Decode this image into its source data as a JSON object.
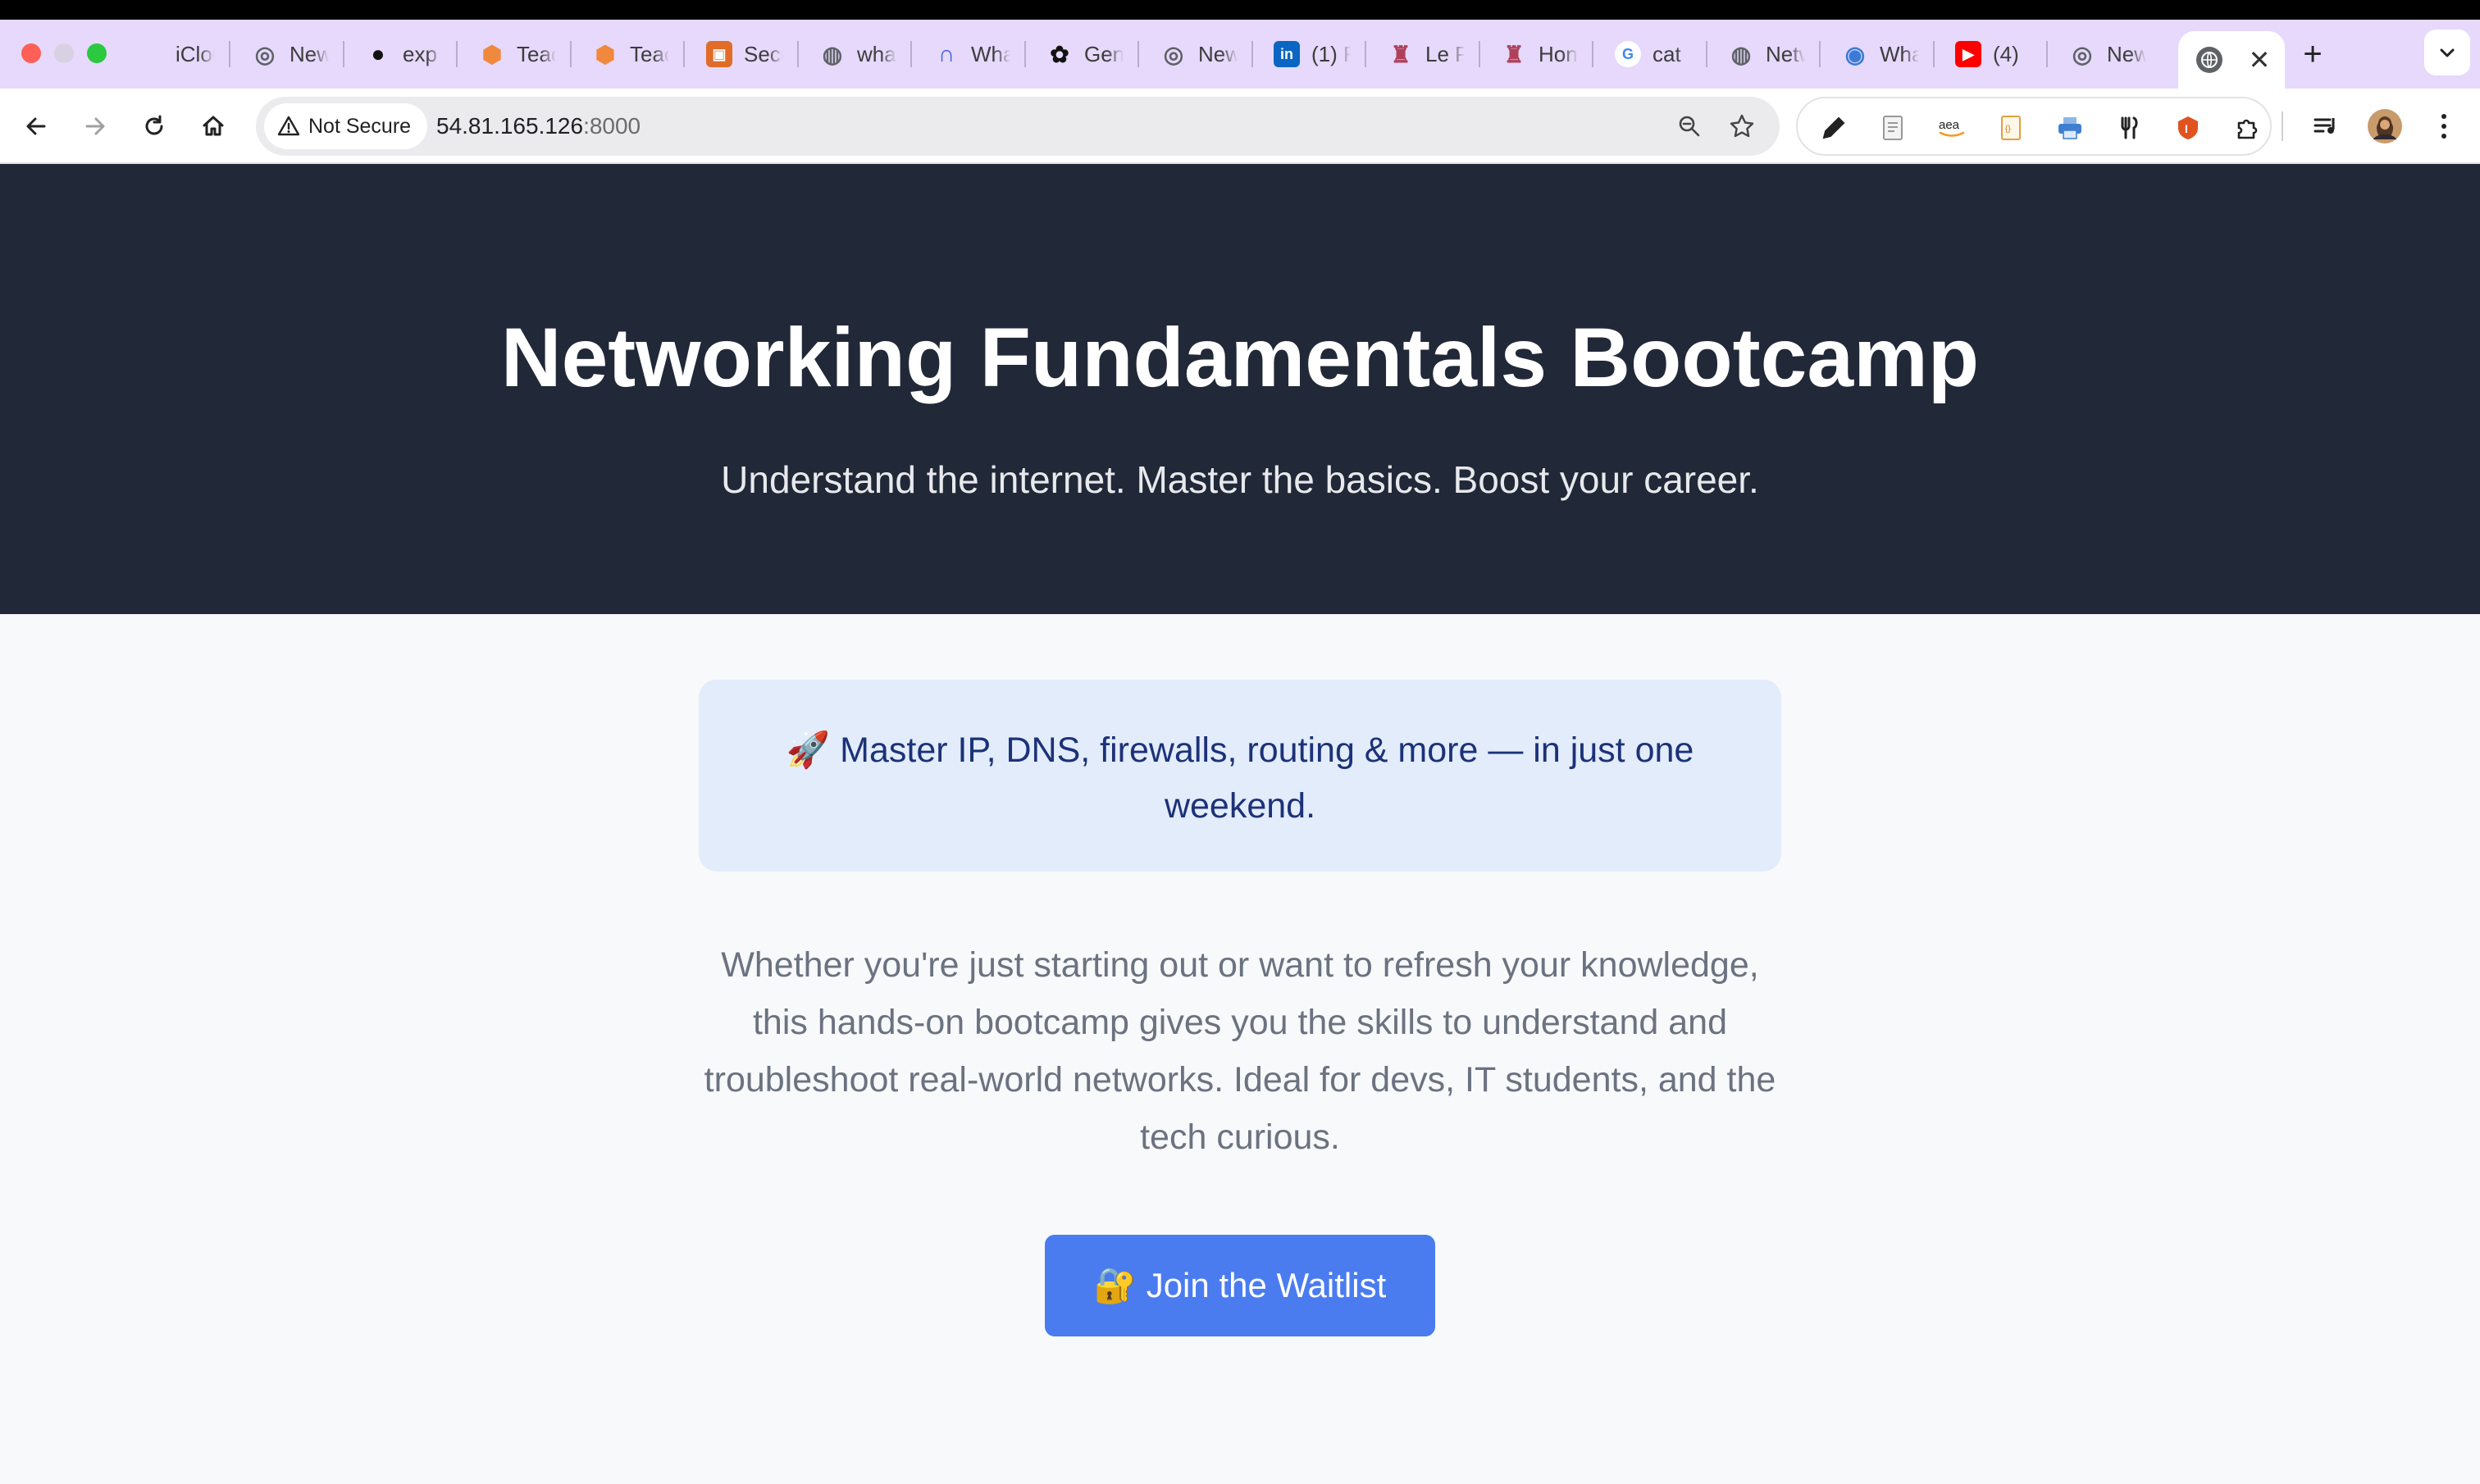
{
  "browser": {
    "tabs": [
      {
        "title": "iCloud",
        "icon": "apple-icon",
        "color": "#555555"
      },
      {
        "title": "New Tab",
        "icon": "chrome-icon",
        "color": "#5f6368"
      },
      {
        "title": "exp",
        "icon": "github-icon",
        "color": "#111111"
      },
      {
        "title": "Teach",
        "icon": "hexagon-icon",
        "color": "#f0883e"
      },
      {
        "title": "Teach",
        "icon": "hexagon-icon",
        "color": "#f0883e"
      },
      {
        "title": "Secu",
        "icon": "security-icon",
        "color": "#e06c27"
      },
      {
        "title": "wha",
        "icon": "globe-icon",
        "color": "#5f6368"
      },
      {
        "title": "Wha",
        "icon": "arc-icon",
        "color": "#3b5bdb"
      },
      {
        "title": "Gen",
        "icon": "openai-icon",
        "color": "#111111"
      },
      {
        "title": "New",
        "icon": "chrome-icon",
        "color": "#5f6368"
      },
      {
        "title": "(1) F",
        "icon": "linkedin-icon",
        "color": "#0a66c2"
      },
      {
        "title": "Le P",
        "icon": "tower-icon",
        "color": "#b0405a"
      },
      {
        "title": "Hon",
        "icon": "tower-icon",
        "color": "#b0405a"
      },
      {
        "title": "cat",
        "icon": "google-icon",
        "color": "#4285f4"
      },
      {
        "title": "Netw",
        "icon": "globe-icon",
        "color": "#5f6368"
      },
      {
        "title": "Wha",
        "icon": "earth-icon",
        "color": "#3a7bd5"
      },
      {
        "title": "(4)",
        "icon": "youtube-icon",
        "color": "#ff0000"
      },
      {
        "title": "New",
        "icon": "chrome-icon",
        "color": "#5f6368"
      }
    ],
    "active_tab_icon": "globe-icon",
    "address": {
      "security_label": "Not Secure",
      "host": "54.81.165.126",
      "port": ":8000"
    }
  },
  "page": {
    "title": "Networking Fundamentals Bootcamp",
    "subtitle": "Understand the internet. Master the basics. Boost your career.",
    "callout": "🚀 Master IP, DNS, firewalls, routing & more — in just one weekend.",
    "description": "Whether you're just starting out or want to refresh your knowledge, this hands-on bootcamp gives you the skills to understand and troubleshoot real-world networks. Ideal for devs, IT students, and the tech curious.",
    "cta_label": "🔐 Join the Waitlist"
  },
  "colors": {
    "hero_bg": "#212838",
    "callout_bg": "#e3ecfb",
    "callout_text": "#1c3278",
    "cta_bg": "#4a7cf0",
    "tabbar_bg": "#e6d9fb"
  }
}
